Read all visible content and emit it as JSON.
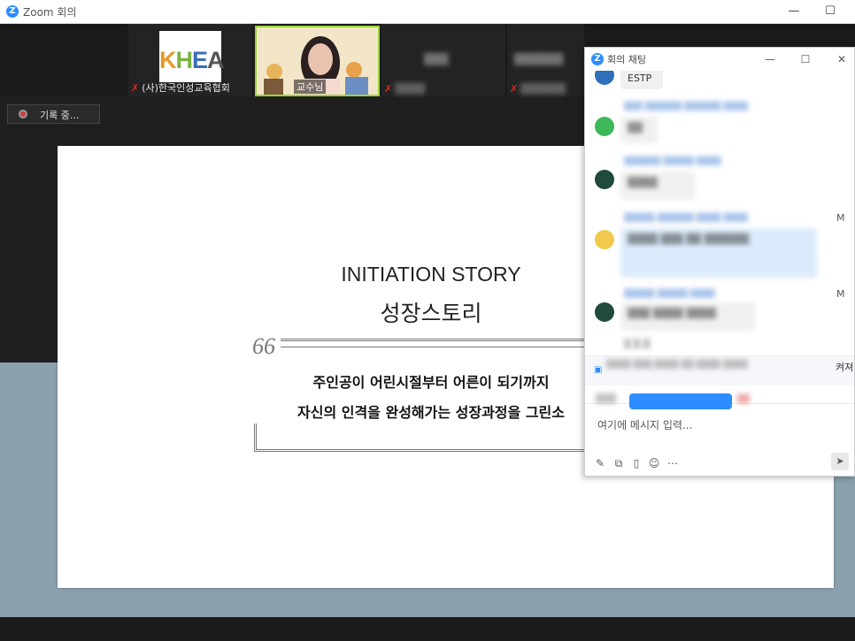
{
  "window": {
    "title": "Zoom 회의",
    "logo_letter": "Z",
    "minimize_glyph": "—",
    "maximize_glyph": "☐"
  },
  "participants": [
    {
      "name": "(사)한국인성교육협회",
      "muted": true,
      "logo_text": "KHEA"
    },
    {
      "name": "교수님",
      "muted": false,
      "highlighted": true
    },
    {
      "name": "",
      "muted": true
    },
    {
      "name": "",
      "muted": true
    }
  ],
  "recording": {
    "label": "기록 중..."
  },
  "slide": {
    "title_en": "INITIATION STORY",
    "title_ko": "성장스토리",
    "quote_mark": "66",
    "line1": "주인공이 어린시절부터 어른이 되기까지",
    "line2": "자신의 인격을 완성해가는 성장과정을 그린소"
  },
  "chat": {
    "title": "회의 채팅",
    "logo_letter": "Z",
    "messages": [
      {
        "text": "ESTP"
      },
      {
        "text": ""
      },
      {
        "text": ""
      },
      {
        "text": ""
      },
      {
        "text": ""
      }
    ],
    "side_marks": [
      "M",
      "M"
    ],
    "notice_suffix": "켜져",
    "input_placeholder": "여기에 메시지 입력...",
    "tools": [
      "edit-icon",
      "screenshot-icon",
      "file-icon",
      "emoji-icon",
      "more-icon"
    ]
  },
  "colors": {
    "zoom_blue": "#2d8cff",
    "speaker_highlight": "#9bd43a",
    "muted_red": "#e02828",
    "background_band": "#8aa0ad"
  }
}
